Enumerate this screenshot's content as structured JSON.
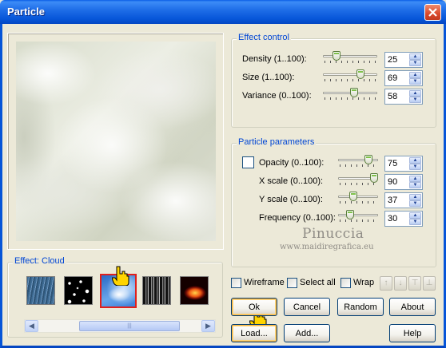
{
  "window": {
    "title": "Particle"
  },
  "effect_control": {
    "legend": "Effect control",
    "rows": [
      {
        "label": "Density (1..100):",
        "value": "25",
        "fraction": 0.25
      },
      {
        "label": "Size (1..100):",
        "value": "69",
        "fraction": 0.69
      },
      {
        "label": "Variance (0..100):",
        "value": "58",
        "fraction": 0.58
      }
    ]
  },
  "particle_parameters": {
    "legend": "Particle parameters",
    "rows": [
      {
        "label": "Opacity (0..100):",
        "value": "75",
        "fraction": 0.75
      },
      {
        "label": "X scale (0..100):",
        "value": "90",
        "fraction": 0.9
      },
      {
        "label": "Y scale (0..100):",
        "value": "37",
        "fraction": 0.37
      },
      {
        "label": "Frequency (0..100):",
        "value": "30",
        "fraction": 0.3
      }
    ]
  },
  "effect_group": {
    "legend": "Effect: Cloud",
    "selected_index": 2
  },
  "options": {
    "wireframe": "Wireframe",
    "select_all": "Select all",
    "wrap": "Wrap"
  },
  "buttons": {
    "ok": "Ok",
    "cancel": "Cancel",
    "random": "Random",
    "about": "About",
    "load": "Load...",
    "add": "Add...",
    "help": "Help"
  },
  "watermark": {
    "name": "Pinuccia",
    "url": "www.maidiregrafica.eu"
  },
  "colors": {
    "titlebar": "#0655d8",
    "legend_text": "#0046d5",
    "selection_border": "#e0201c"
  }
}
